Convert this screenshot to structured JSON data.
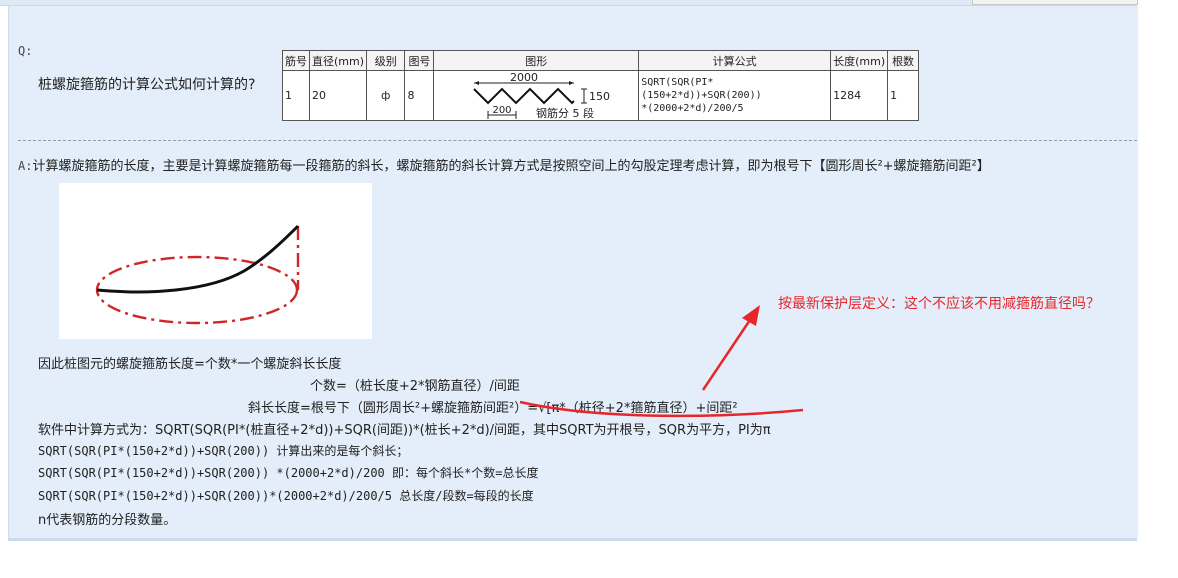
{
  "question": {
    "label": "Q:",
    "text": "桩螺旋箍筋的计算公式如何计算的?"
  },
  "table": {
    "headers": [
      "筋号",
      "直径(mm)",
      "级别",
      "图号",
      "图形",
      "计算公式",
      "长度(mm)",
      "根数"
    ],
    "row": {
      "no": "1",
      "diameter": "20",
      "grade": "ф",
      "figure_no": "8",
      "shape": {
        "total_length": "2000",
        "height": "150",
        "pitch": "200",
        "segments_text": "钢筋分 5 段"
      },
      "formula_line1": "SQRT(SQR(PI*(150+2*d))+SQR(200))",
      "formula_line2": "*(2000+2*d)/200/5",
      "length": "1284",
      "count": "1"
    }
  },
  "answer": {
    "label": "A:",
    "text": "计算螺旋箍筋的长度，主要是计算螺旋箍筋每一段箍筋的斜长，螺旋箍筋的斜长计算方式是按照空间上的勾股定理考虑计算，即为根号下【圆形周长²+螺旋箍筋间距²】",
    "lines": [
      "因此桩图元的螺旋箍筋长度=个数*一个螺旋斜长长度",
      "个数=（桩长度+2*钢筋直径）/间距",
      "斜长长度=根号下（圆形周长²+螺旋箍筋间距²）=√[π*（桩径+2*箍筋直径）+间距²",
      "软件中计算方式为：SQRT(SQR(PI*(桩直径+2*d))+SQR(间距))*(桩长+2*d)/间距，其中SQRT为开根号，SQR为平方，PI为π",
      "SQRT(SQR(PI*(150+2*d))+SQR(200)) 计算出来的是每个斜长；",
      "SQRT(SQR(PI*(150+2*d))+SQR(200)) *(2000+2*d)/200 即：每个斜长*个数=总长度",
      "SQRT(SQR(PI*(150+2*d))+SQR(200))*(2000+2*d)/200/5 总长度/段数=每段的长度",
      "n代表钢筋的分段数量。"
    ]
  },
  "annotation": {
    "text": "按最新保护层定义：这个不应该不用减箍筋直径吗？",
    "color": "#e8262a"
  },
  "colors": {
    "panel_bg": "#e3eefa",
    "spiral_dash": "#d0262a"
  }
}
